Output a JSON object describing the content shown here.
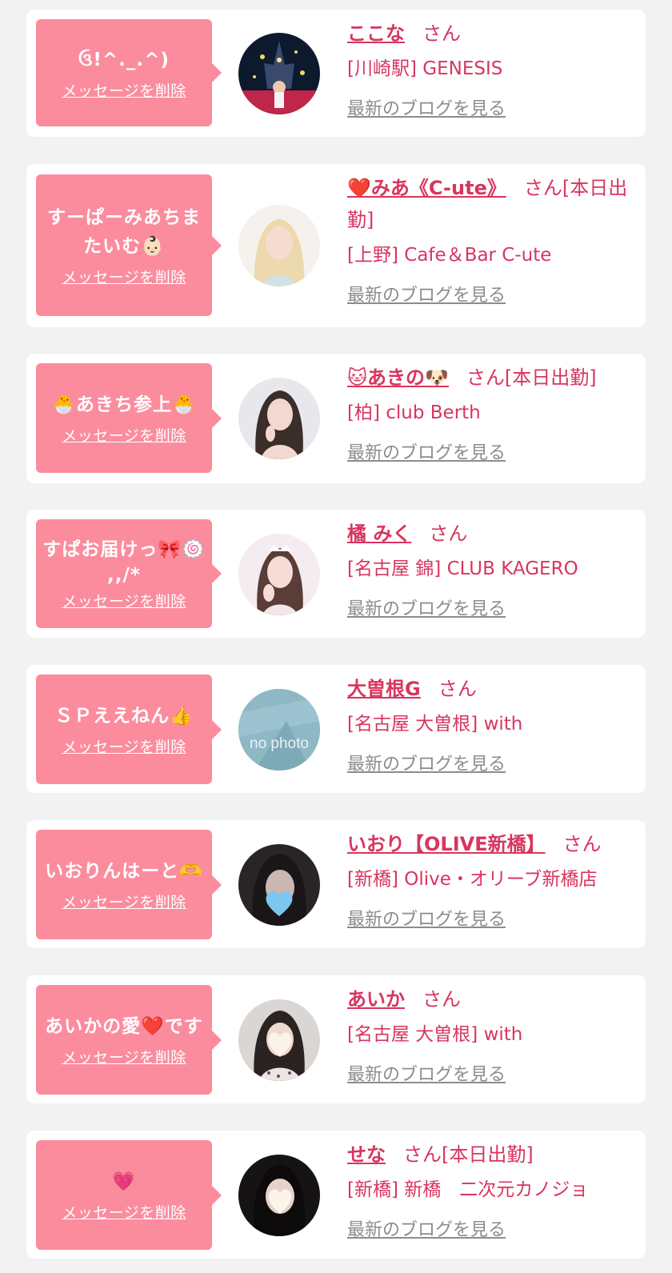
{
  "delete_label": "メッセージを削除",
  "blog_label": "最新のブログを見る",
  "suffix": "さん",
  "items": [
    {
      "message": "ઉ!^._.^)",
      "name": "ここな",
      "extra": "",
      "shop": "[川崎駅] GENESIS"
    },
    {
      "message": "すーぱーみあちまたいむ👶🏻",
      "name": "❤️みあ《C-ute》",
      "extra": "[本日出勤]",
      "shop": "[上野] Cafe＆Bar C-ute"
    },
    {
      "message": "🐣あきち参上🐣",
      "name": "🐱あきの🐶",
      "extra": "[本日出勤]",
      "shop": "[柏] club Berth"
    },
    {
      "message": "すぱお届けっ🎀🍥 ,,/*",
      "name": "橘 みく",
      "extra": "",
      "shop": "[名古屋 錦] CLUB KAGERO"
    },
    {
      "message": "ＳＰええねん👍",
      "name": "大曽根G",
      "extra": "",
      "shop": "[名古屋 大曽根] with",
      "no_photo_text": "no photo"
    },
    {
      "message": "いおりんはーと🫶",
      "name": "いおり【OLIVE新橋】",
      "extra": "",
      "shop": "[新橋] Olive・オリーブ新橋店"
    },
    {
      "message": "あいかの愛❤️です",
      "name": "あいか",
      "extra": "",
      "shop": "[名古屋 大曽根] with"
    },
    {
      "message": "💗",
      "name": "せな",
      "extra": "[本日出勤]",
      "shop": "[新橋] 新橋　二次元カノジョ"
    }
  ]
}
